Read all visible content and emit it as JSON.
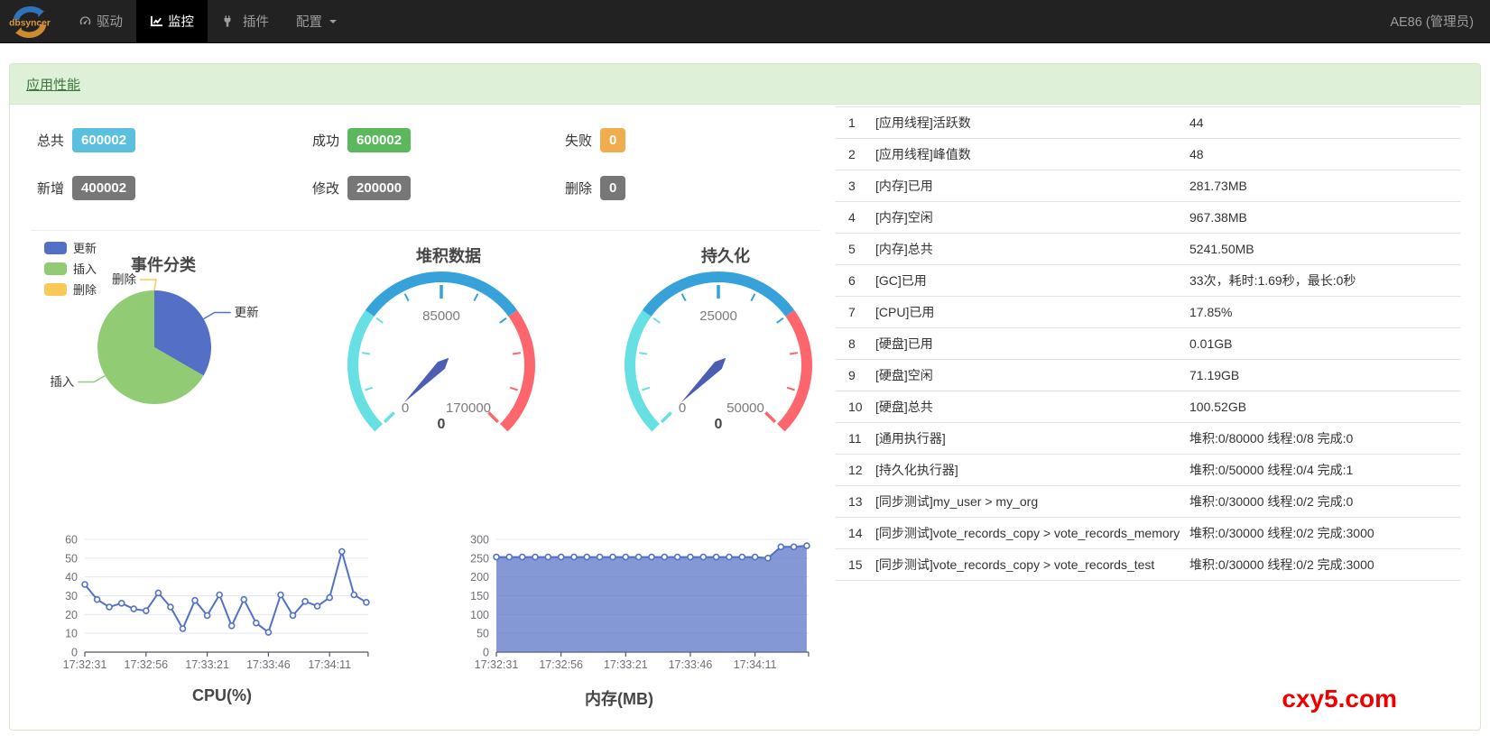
{
  "navbar": {
    "brand": "dbsyncer",
    "items": [
      {
        "label": "驱动",
        "icon": "dashboard-icon",
        "active": false
      },
      {
        "label": "监控",
        "icon": "monitor-chart-icon",
        "active": true
      },
      {
        "label": "插件",
        "icon": "plug-icon",
        "active": false
      },
      {
        "label": "配置",
        "icon": "caret-down-icon",
        "active": false,
        "dropdown": true
      }
    ],
    "user": "AE86 (管理员)"
  },
  "panel": {
    "title": "应用性能"
  },
  "stats": [
    {
      "label": "总共",
      "value": "600002",
      "color": "#5bc0de"
    },
    {
      "label": "成功",
      "value": "600002",
      "color": "#5cb85c"
    },
    {
      "label": "失败",
      "value": "0",
      "color": "#f0ad4e"
    },
    {
      "label": "新增",
      "value": "400002",
      "color": "#777777"
    },
    {
      "label": "修改",
      "value": "200000",
      "color": "#777777"
    },
    {
      "label": "删除",
      "value": "0",
      "color": "#777777"
    }
  ],
  "chart_data": [
    {
      "id": "events_pie",
      "type": "pie",
      "title": "事件分类",
      "legend": [
        "更新",
        "插入",
        "删除"
      ],
      "legend_position": "left-top",
      "series": [
        {
          "name": "更新",
          "value": 200000,
          "color": "#5470c6",
          "label_side": "right"
        },
        {
          "name": "插入",
          "value": 400002,
          "color": "#91cc75",
          "label_side": "left"
        },
        {
          "name": "删除",
          "value": 0,
          "color": "#fac858",
          "label_side": "left"
        }
      ]
    },
    {
      "id": "stack_gauge",
      "type": "gauge",
      "title": "堆积数据",
      "min": 0,
      "max": 170000,
      "value": 0,
      "axis_labels": [
        "0",
        "85000",
        "170000"
      ],
      "detail": "0",
      "color_stops": [
        [
          0.3,
          "#67e0e3"
        ],
        [
          0.7,
          "#37a2da"
        ],
        [
          1,
          "#fd666d"
        ]
      ],
      "needle_color": "#4c5db4"
    },
    {
      "id": "persist_gauge",
      "type": "gauge",
      "title": "持久化",
      "min": 0,
      "max": 50000,
      "value": 0,
      "axis_labels": [
        "0",
        "25000",
        "50000"
      ],
      "detail": "0",
      "color_stops": [
        [
          0.3,
          "#67e0e3"
        ],
        [
          0.7,
          "#37a2da"
        ],
        [
          1,
          "#fd666d"
        ]
      ],
      "needle_color": "#4c5db4"
    },
    {
      "id": "cpu_line",
      "type": "line",
      "title": "CPU(%)",
      "x": [
        "17:32:31",
        "17:32:36",
        "17:32:41",
        "17:32:46",
        "17:32:51",
        "17:32:56",
        "17:33:01",
        "17:33:06",
        "17:33:11",
        "17:33:16",
        "17:33:21",
        "17:33:26",
        "17:33:31",
        "17:33:36",
        "17:33:41",
        "17:33:46",
        "17:33:51",
        "17:33:56",
        "17:34:01",
        "17:34:06",
        "17:34:11",
        "17:34:16",
        "17:34:21",
        "17:34:26"
      ],
      "tick_indices": [
        0,
        5,
        10,
        15,
        20
      ],
      "values": [
        36,
        28,
        24,
        26,
        23,
        22,
        31.5,
        24,
        12.5,
        27.5,
        19.5,
        30.5,
        14,
        28,
        15.5,
        10.5,
        30.5,
        19.5,
        27,
        24.5,
        29,
        53.5,
        30.5,
        26.5
      ],
      "ylim": [
        0,
        60
      ],
      "ytick_step": 10,
      "line_color": "#5470c6",
      "grid": true
    },
    {
      "id": "mem_area",
      "type": "area",
      "title": "内存(MB)",
      "x": [
        "17:32:31",
        "17:32:36",
        "17:32:41",
        "17:32:46",
        "17:32:51",
        "17:32:56",
        "17:33:01",
        "17:33:06",
        "17:33:11",
        "17:33:16",
        "17:33:21",
        "17:33:26",
        "17:33:31",
        "17:33:36",
        "17:33:41",
        "17:33:46",
        "17:33:51",
        "17:33:56",
        "17:34:01",
        "17:34:06",
        "17:34:11",
        "17:34:16",
        "17:34:21",
        "17:34:26",
        "17:34:31"
      ],
      "tick_indices": [
        0,
        5,
        10,
        15,
        20
      ],
      "values": [
        253,
        253,
        253,
        253,
        253,
        253,
        253,
        253,
        253,
        253,
        253,
        253,
        253,
        253,
        253,
        253,
        253,
        253,
        253,
        253,
        253,
        250,
        280,
        280,
        283
      ],
      "ylim": [
        0,
        300
      ],
      "ytick_step": 50,
      "line_color": "#5470c6",
      "area_color": "rgba(84,112,198,0.72)",
      "grid": true
    }
  ],
  "table": {
    "rows": [
      {
        "num": "1",
        "name": "[应用线程]活跃数",
        "value": "44"
      },
      {
        "num": "2",
        "name": "[应用线程]峰值数",
        "value": "48"
      },
      {
        "num": "3",
        "name": "[内存]已用",
        "value": "281.73MB"
      },
      {
        "num": "4",
        "name": "[内存]空闲",
        "value": "967.38MB"
      },
      {
        "num": "5",
        "name": "[内存]总共",
        "value": "5241.50MB"
      },
      {
        "num": "6",
        "name": "[GC]已用",
        "value": "33次，耗时:1.69秒，最长:0秒"
      },
      {
        "num": "7",
        "name": "[CPU]已用",
        "value": "17.85%"
      },
      {
        "num": "8",
        "name": "[硬盘]已用",
        "value": "0.01GB"
      },
      {
        "num": "9",
        "name": "[硬盘]空闲",
        "value": "71.19GB"
      },
      {
        "num": "10",
        "name": "[硬盘]总共",
        "value": "100.52GB"
      },
      {
        "num": "11",
        "name": "[通用执行器]",
        "value": "堆积:0/80000 线程:0/8 完成:0"
      },
      {
        "num": "12",
        "name": "[持久化执行器]",
        "value": "堆积:0/50000 线程:0/4 完成:1"
      },
      {
        "num": "13",
        "name": "[同步测试]my_user > my_org",
        "value": "堆积:0/30000 线程:0/2 完成:0"
      },
      {
        "num": "14",
        "name": "[同步测试]vote_records_copy > vote_records_memory",
        "value": "堆积:0/30000 线程:0/2 完成:3000"
      },
      {
        "num": "15",
        "name": "[同步测试]vote_records_copy > vote_records_test",
        "value": "堆积:0/30000 线程:0/2 完成:3000"
      }
    ]
  },
  "watermark": {
    "text": "cxy5.com",
    "color": "#ee0000"
  }
}
